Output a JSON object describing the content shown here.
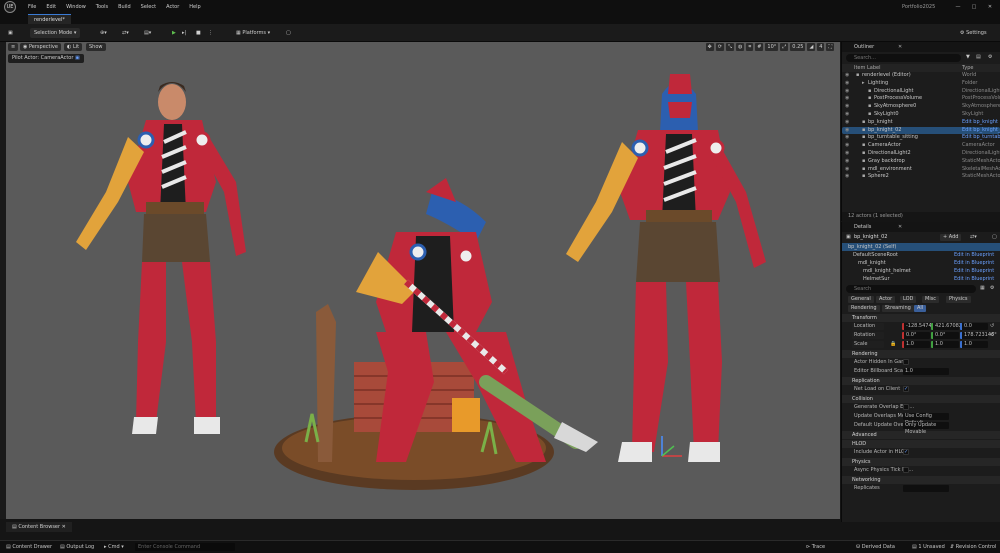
{
  "menubar": {
    "logo": "UE",
    "items": [
      "File",
      "Edit",
      "Window",
      "Tools",
      "Build",
      "Select",
      "Actor",
      "Help"
    ],
    "project": "Portfolio2025",
    "win_min": "—",
    "win_max": "□",
    "win_close": "✕"
  },
  "tab": {
    "label": "renderlevel*"
  },
  "toolbar": {
    "selection_mode": "Selection Mode",
    "platforms": "Platforms",
    "settings": "Settings"
  },
  "viewport": {
    "perspective": "Perspective",
    "lit": "Lit",
    "show": "Show",
    "pilot": "Pilot Actor: CameraActor",
    "snap_angle": "10°",
    "snap_scale": "0.25",
    "cam_speed": "4"
  },
  "outliner": {
    "title": "Outliner",
    "search_placeholder": "Search...",
    "col_label": "Item Label",
    "col_type": "Type",
    "rows": [
      {
        "label": "renderlevel (Editor)",
        "type": "World",
        "indent": 0
      },
      {
        "label": "Lighting",
        "type": "Folder",
        "indent": 1
      },
      {
        "label": "DirectionalLight",
        "type": "DirectionalLight",
        "indent": 2
      },
      {
        "label": "PostProcessVolume",
        "type": "PostProcessVolume",
        "indent": 2
      },
      {
        "label": "SkyAtmosphere0",
        "type": "SkyAtmosphere",
        "indent": 2
      },
      {
        "label": "SkyLight0",
        "type": "SkyLight",
        "indent": 2
      },
      {
        "label": "bp_knight",
        "type": "Edit bp_knight",
        "indent": 1,
        "bp": true
      },
      {
        "label": "bp_knight_02",
        "type": "Edit bp_knight_02",
        "indent": 1,
        "bp": true,
        "selected": true
      },
      {
        "label": "bp_turntable_sitting",
        "type": "Edit bp_turntable",
        "indent": 1,
        "bp": true
      },
      {
        "label": "CameraActor",
        "type": "CameraActor",
        "indent": 1
      },
      {
        "label": "DirectionalLight2",
        "type": "DirectionalLight",
        "indent": 1
      },
      {
        "label": "Gray backdrop",
        "type": "StaticMeshActor",
        "indent": 1
      },
      {
        "label": "mdl_environment",
        "type": "SkeletalMeshActor",
        "indent": 1
      },
      {
        "label": "Sphere2",
        "type": "StaticMeshActor",
        "indent": 1
      }
    ],
    "footer": "12 actors (1 selected)"
  },
  "details": {
    "title": "Details",
    "actor_name": "bp_knight_02",
    "add_label": "+ Add",
    "components": [
      {
        "label": "bp_knight_02 (Self)",
        "link": "",
        "selected": true
      },
      {
        "label": "DefaultSceneRoot",
        "link": "Edit in Blueprint"
      },
      {
        "label": "mdl_knight",
        "link": "Edit in Blueprint"
      },
      {
        "label": "mdl_knight_helmet",
        "link": "Edit in Blueprint"
      },
      {
        "label": "HelmetSur",
        "link": "Edit in Blueprint"
      }
    ],
    "search_placeholder": "Search",
    "filter_tabs_1": [
      "General",
      "Actor",
      "LOD",
      "Misc",
      "Physics"
    ],
    "filter_tabs_2": [
      "Rendering",
      "Streaming",
      "All"
    ],
    "transform": {
      "section": "Transform",
      "location_label": "Location",
      "location": [
        "-128.5474000",
        "421.670829",
        "0.0"
      ],
      "rotation_label": "Rotation",
      "rotation": [
        "0.0°",
        "0.0°",
        "178.723146°"
      ],
      "scale_label": "Scale",
      "scale": [
        "1.0",
        "1.0",
        "1.0"
      ]
    },
    "sections": [
      {
        "title": "Rendering",
        "props": [
          {
            "label": "Actor Hidden In Game",
            "type": "check",
            "value": ""
          },
          {
            "label": "Editor Billboard Scale",
            "type": "box",
            "value": "1.0"
          }
        ]
      },
      {
        "title": "Replication",
        "props": [
          {
            "label": "Net Load on Client",
            "type": "check",
            "value": "✓"
          }
        ]
      },
      {
        "title": "Collision",
        "props": [
          {
            "label": "Generate Overlap Eve...",
            "type": "check",
            "value": ""
          },
          {
            "label": "Update Overlaps Meth...",
            "type": "box",
            "value": "Use Config Default"
          },
          {
            "label": "Default Update Overla...",
            "type": "box",
            "value": "Only Update Movable"
          }
        ]
      },
      {
        "title": "Advanced",
        "props": []
      },
      {
        "title": "HLOD",
        "props": [
          {
            "label": "Include Actor in HLOD",
            "type": "check",
            "value": "✓"
          }
        ]
      },
      {
        "title": "Physics",
        "props": [
          {
            "label": "Async Physics Tick En...",
            "type": "check",
            "value": ""
          }
        ]
      },
      {
        "title": "Networking",
        "props": [
          {
            "label": "Replicates",
            "type": "box",
            "value": ""
          }
        ]
      }
    ]
  },
  "bottom": {
    "content_browser_tab": "Content Browser",
    "content_drawer": "Content Drawer",
    "output_log": "Output Log",
    "cmd": "Cmd",
    "cmd_placeholder": "Enter Console Command",
    "trace": "Trace",
    "derived_data": "Derived Data",
    "unsaved": "1 Unsaved",
    "revision_control": "Revision Control"
  },
  "colors": {
    "accent": "#264f78",
    "link": "#6aa0ff"
  }
}
